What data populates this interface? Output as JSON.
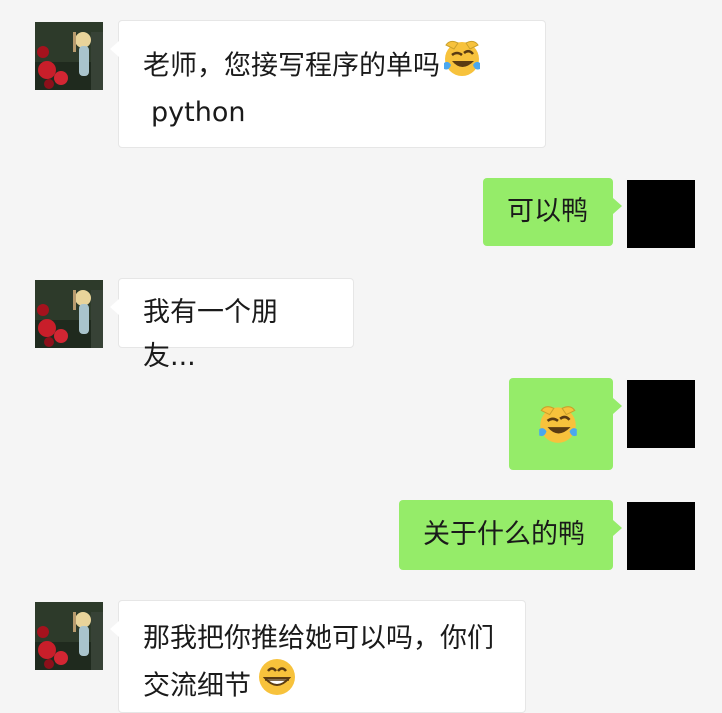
{
  "messages": [
    {
      "side": "in",
      "text": "老师，您接写程序的单吗",
      "emoji": "rolling-on-floor-laughing",
      "text2": "python"
    },
    {
      "side": "out",
      "text": "可以鸭"
    },
    {
      "side": "in",
      "text": "我有一个朋友..."
    },
    {
      "side": "out",
      "emoji": "rolling-on-floor-laughing"
    },
    {
      "side": "out",
      "text": "关于什么的鸭"
    },
    {
      "side": "in",
      "text": "那我把你推给她可以吗，你们交流细节",
      "emoji": "grinning-face"
    }
  ],
  "colors": {
    "background": "#f5f5f5",
    "incoming_bubble": "#ffffff",
    "outgoing_bubble": "#95ec69"
  }
}
